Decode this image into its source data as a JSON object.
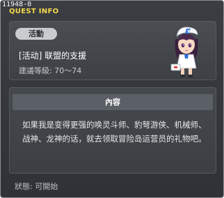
{
  "window": {
    "id": "11948-0",
    "title": "QUEST INFO"
  },
  "quest": {
    "badge": "活動",
    "name": "[活动] 联盟的支援",
    "level": "建議等級: 70～74",
    "npc_icon": "npc-girl-portrait"
  },
  "content": {
    "header": "內容",
    "text": "如果我是变得更强的唤灵斗师、豹弩游侠、机械师、战神、龙神的话，就去领取冒险岛运营员的礼物吧。"
  },
  "status": {
    "text": "狀態:  可開始"
  }
}
